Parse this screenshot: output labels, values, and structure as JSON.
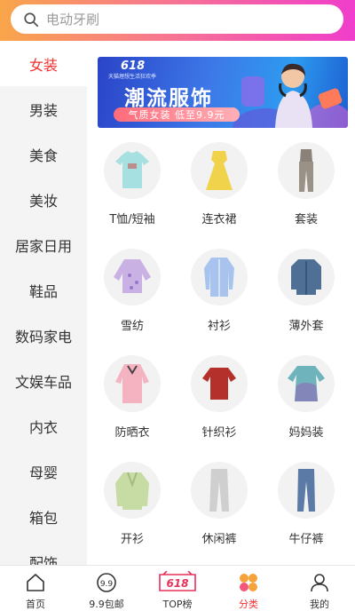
{
  "search": {
    "placeholder": "电动牙刷"
  },
  "sidebar": {
    "items": [
      {
        "label": "女装",
        "active": true
      },
      {
        "label": "男装"
      },
      {
        "label": "美食"
      },
      {
        "label": "美妆"
      },
      {
        "label": "居家日用"
      },
      {
        "label": "鞋品"
      },
      {
        "label": "数码家电"
      },
      {
        "label": "文娱车品"
      },
      {
        "label": "内衣"
      },
      {
        "label": "母婴"
      },
      {
        "label": "箱包"
      },
      {
        "label": "配饰"
      }
    ]
  },
  "banner": {
    "logo": "618",
    "subtitle": "天猫理想生活狂欢季",
    "title": "潮流服饰",
    "pill": "气质女装 低至9.9元"
  },
  "categories": [
    {
      "label": "T恤/短袖",
      "icon": "tshirt-icon"
    },
    {
      "label": "连衣裙",
      "icon": "dress-icon"
    },
    {
      "label": "套装",
      "icon": "suit-icon"
    },
    {
      "label": "雪纺",
      "icon": "chiffon-icon"
    },
    {
      "label": "衬衫",
      "icon": "shirt-icon"
    },
    {
      "label": "薄外套",
      "icon": "jacket-icon"
    },
    {
      "label": "防晒衣",
      "icon": "sun-protection-icon"
    },
    {
      "label": "针织衫",
      "icon": "knit-icon"
    },
    {
      "label": "妈妈装",
      "icon": "mom-wear-icon"
    },
    {
      "label": "开衫",
      "icon": "cardigan-icon"
    },
    {
      "label": "休闲裤",
      "icon": "casual-pants-icon"
    },
    {
      "label": "牛仔裤",
      "icon": "jeans-icon"
    }
  ],
  "bottom_nav": [
    {
      "label": "首页",
      "icon": "home-icon"
    },
    {
      "label": "9.9包邮",
      "icon": "nine-nine-icon"
    },
    {
      "label": "TOP榜",
      "icon": "top-618-icon"
    },
    {
      "label": "分类",
      "icon": "category-icon",
      "active": true
    },
    {
      "label": "我的",
      "icon": "user-icon"
    }
  ],
  "colors": {
    "accent": "#f23131",
    "header_start": "#f9a54a",
    "header_end": "#f03dcb"
  }
}
